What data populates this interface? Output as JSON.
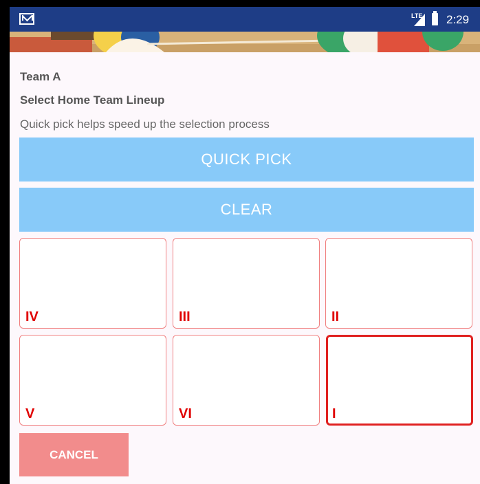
{
  "status_bar": {
    "network_label": "LTE",
    "time": "2:29",
    "mail_icon": "mail-icon",
    "signal_icon": "signal-icon",
    "battery_icon": "battery-icon"
  },
  "header": {
    "team_name": "Team A",
    "subtitle": "Select Home Team Lineup",
    "hint": "Quick pick helps speed up the selection process"
  },
  "actions": {
    "quick_pick_label": "QUICK PICK",
    "clear_label": "CLEAR",
    "cancel_label": "CANCEL"
  },
  "court": {
    "positions": [
      {
        "label": "IV",
        "selected": false
      },
      {
        "label": "III",
        "selected": false
      },
      {
        "label": "II",
        "selected": false
      },
      {
        "label": "V",
        "selected": false
      },
      {
        "label": "VI",
        "selected": false
      },
      {
        "label": "I",
        "selected": true
      }
    ]
  },
  "colors": {
    "status_bar": "#1e3d86",
    "button_blue": "#88caf9",
    "cancel_red": "#f28c8c",
    "position_red": "#e00000"
  }
}
